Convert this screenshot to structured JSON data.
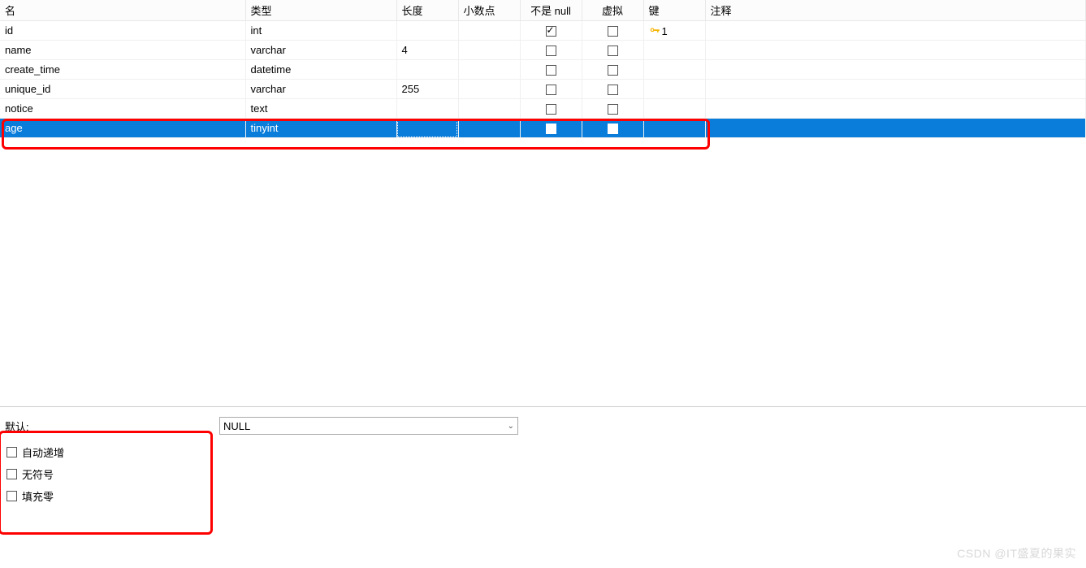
{
  "headers": {
    "name": "名",
    "type": "类型",
    "length": "长度",
    "decimal": "小数点",
    "notnull": "不是 null",
    "virtual": "虚拟",
    "key": "键",
    "comment": "注释"
  },
  "rows": [
    {
      "name": "id",
      "type": "int",
      "length": "",
      "decimal": "",
      "notnull": true,
      "virtual": false,
      "key": "1",
      "comment": ""
    },
    {
      "name": "name",
      "type": "varchar",
      "length": "4",
      "decimal": "",
      "notnull": false,
      "virtual": false,
      "key": "",
      "comment": ""
    },
    {
      "name": "create_time",
      "type": "datetime",
      "length": "",
      "decimal": "",
      "notnull": false,
      "virtual": false,
      "key": "",
      "comment": ""
    },
    {
      "name": "unique_id",
      "type": "varchar",
      "length": "255",
      "decimal": "",
      "notnull": false,
      "virtual": false,
      "key": "",
      "comment": ""
    },
    {
      "name": "notice",
      "type": "text",
      "length": "",
      "decimal": "",
      "notnull": false,
      "virtual": false,
      "key": "",
      "comment": ""
    },
    {
      "name": "age",
      "type": "tinyint",
      "length": "",
      "decimal": "",
      "notnull": false,
      "virtual": false,
      "key": "",
      "comment": "",
      "selected": true
    }
  ],
  "bottom": {
    "default_label": "默认:",
    "default_value": "NULL",
    "options": {
      "auto_increment": "自动递增",
      "unsigned": "无符号",
      "zerofill": "填充零"
    }
  },
  "watermark": "CSDN @IT盛夏的果实"
}
